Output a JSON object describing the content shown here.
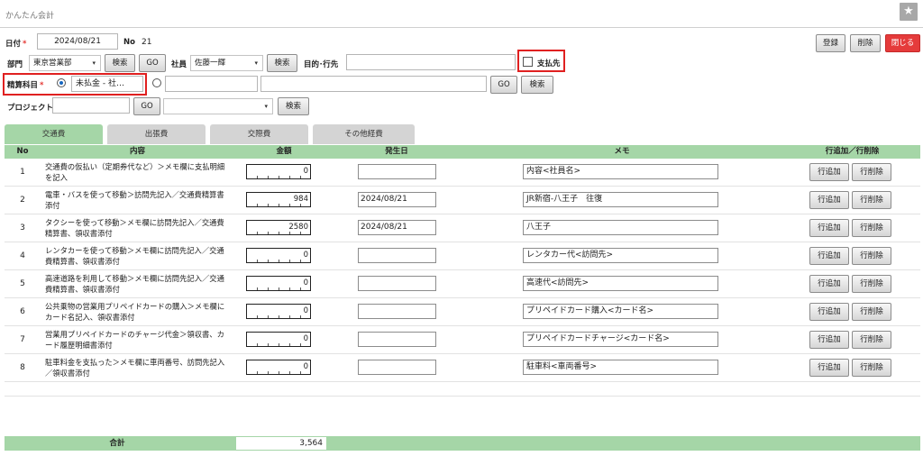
{
  "app": {
    "title": "かんたん会計",
    "star_icon": "star-icon"
  },
  "header": {
    "date_label": "日付",
    "date_value": "2024/08/21",
    "no_label": "No",
    "no_value": "21",
    "dept_label": "部門",
    "dept_value": "東京営業部",
    "search_label": "検索",
    "go_label": "GO",
    "employee_label": "社員",
    "employee_value": "佐藤一輝",
    "purpose_label": "目的･行先",
    "purpose_value": "",
    "payee_label": "支払先",
    "account_label": "精算科目",
    "account_value": "未払金 - 社…",
    "project_label": "プロジェクト",
    "project_value": "",
    "required_mark": "*"
  },
  "actions": {
    "register": "登録",
    "delete": "削除",
    "close": "閉じる"
  },
  "tabs": [
    {
      "label": "交通費",
      "active": true
    },
    {
      "label": "出張費",
      "active": false
    },
    {
      "label": "交際費",
      "active": false
    },
    {
      "label": "その他経費",
      "active": false
    }
  ],
  "columns": {
    "no": "No",
    "desc": "内容",
    "amount": "金額",
    "date": "発生日",
    "memo": "メモ",
    "action": "行追加／行削除"
  },
  "row_buttons": {
    "add": "行追加",
    "del": "行削除"
  },
  "rows": [
    {
      "no": "1",
      "desc": "交通費の仮払い（定期券代など）＞メモ欄に支払明細を記入",
      "amount": "0",
      "date": "",
      "memo": "内容<社員名>"
    },
    {
      "no": "2",
      "desc": "電車・バスを使って移動＞訪問先記入／交通費精算書添付",
      "amount": "984",
      "date": "2024/08/21",
      "memo": "JR新宿-八王子　往復"
    },
    {
      "no": "3",
      "desc": "タクシーを使って移動＞メモ欄に訪問先記入／交通費精算書、領収書添付",
      "amount": "2580",
      "date": "2024/08/21",
      "memo": "八王子"
    },
    {
      "no": "4",
      "desc": "レンタカーを使って移動＞メモ欄に訪問先記入／交通費精算書、領収書添付",
      "amount": "0",
      "date": "",
      "memo": "レンタカー代<訪問先>"
    },
    {
      "no": "5",
      "desc": "高速道路を利用して移動＞メモ欄に訪問先記入／交通費精算書、領収書添付",
      "amount": "0",
      "date": "",
      "memo": "高速代<訪問先>"
    },
    {
      "no": "6",
      "desc": "公共乗物の営業用プリペイドカードの購入＞メモ欄にカード名記入、領収書添付",
      "amount": "0",
      "date": "",
      "memo": "プリペイドカード購入<カード名>"
    },
    {
      "no": "7",
      "desc": "営業用プリペイドカードのチャージ代金＞領収書、カード履歴明細書添付",
      "amount": "0",
      "date": "",
      "memo": "プリペイドカードチャージ<カード名>"
    },
    {
      "no": "8",
      "desc": "駐車料金を支払った＞メモ欄に車両番号、訪問先記入／領収書添付",
      "amount": "0",
      "date": "",
      "memo": "駐車料<車両番号>"
    }
  ],
  "footer": {
    "total_label": "合計",
    "total_value": "3,564"
  }
}
